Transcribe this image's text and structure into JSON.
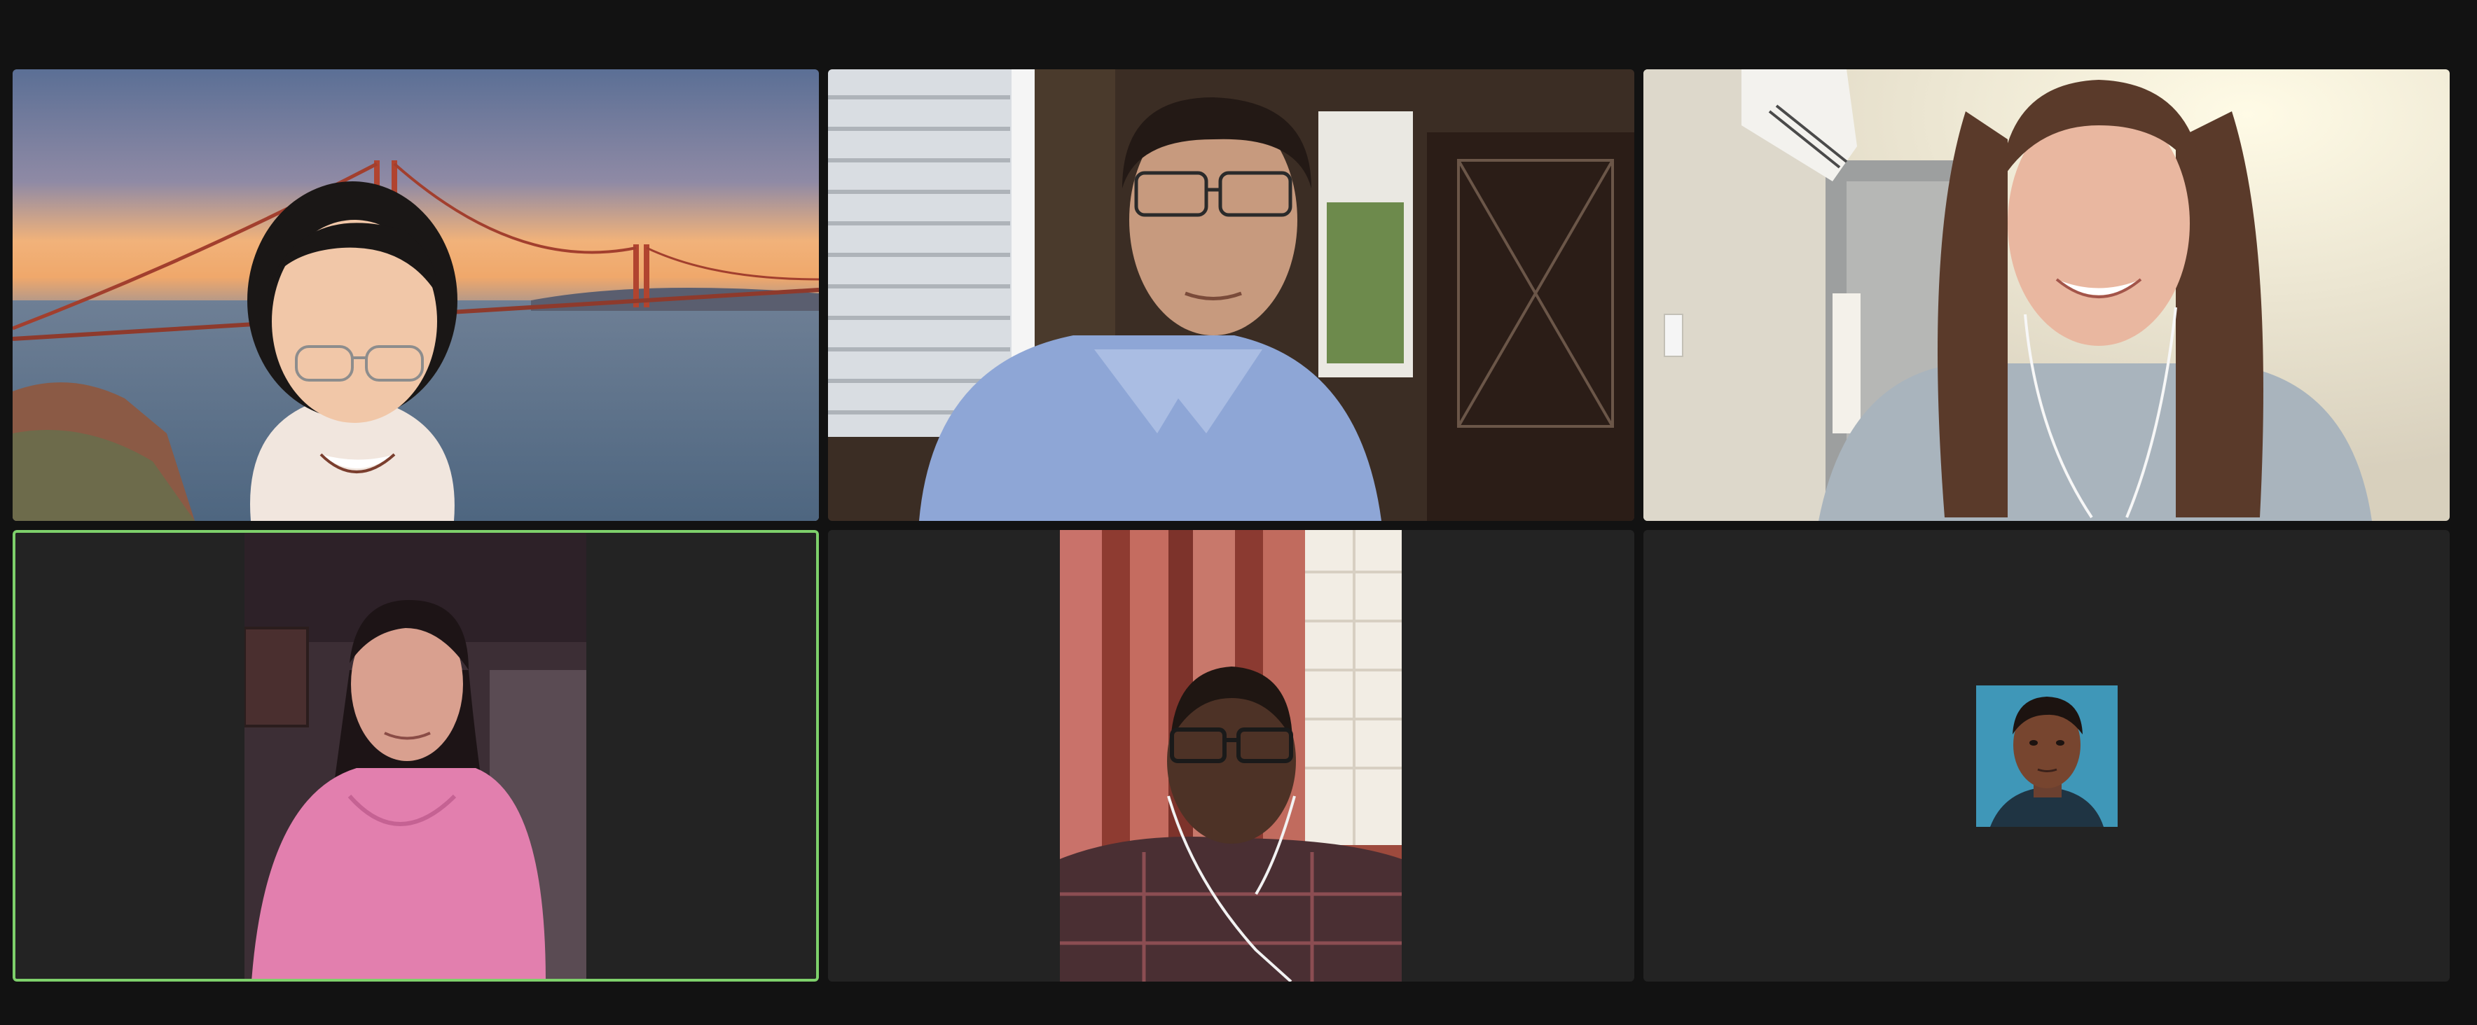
{
  "app": {
    "window": "video-meeting-gallery-view"
  },
  "gallery": {
    "active_speaker_color": "#7ed06b",
    "tiles": [
      {
        "kind": "video",
        "scene": "golden-gate-virtual-background",
        "active": false
      },
      {
        "kind": "video",
        "scene": "home-office-window",
        "active": false
      },
      {
        "kind": "video",
        "scene": "bright-room-air-conditioner",
        "active": false
      },
      {
        "kind": "video",
        "scene": "portrait-pink-hoodie",
        "active": true
      },
      {
        "kind": "video",
        "scene": "portrait-red-curtains",
        "active": false
      },
      {
        "kind": "profile-picture",
        "scene": "avatar-blue-background",
        "active": false
      }
    ]
  }
}
